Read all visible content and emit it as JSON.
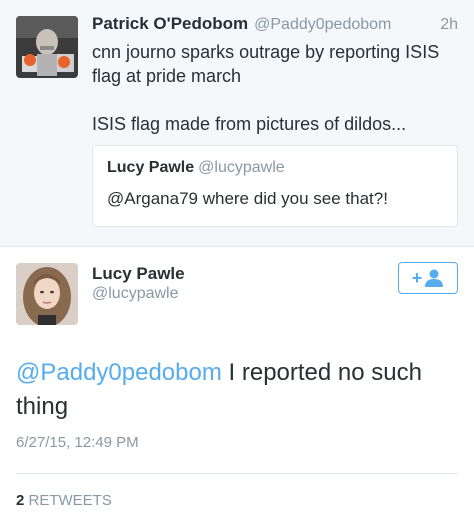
{
  "reply_tweet": {
    "author_name": "Patrick O'Pedobom",
    "author_handle": "@Paddy0pedobom",
    "time": "2h",
    "text_line1": "cnn journo sparks outrage by reporting ISIS flag at pride march",
    "text_line2": "ISIS flag made from pictures of dildos...",
    "avatar_icon": "profile-photo-icon",
    "quoted": {
      "author_name": "Lucy Pawle",
      "author_handle": "@lucypawle",
      "text": "@Argana79 where did you see that?!"
    }
  },
  "main_tweet": {
    "author_name": "Lucy Pawle",
    "author_handle": "@lucypawle",
    "avatar_icon": "profile-photo-icon",
    "follow_icon": "follow-user-icon",
    "follow_label": "+",
    "mention": "@Paddy0pedobom",
    "text_rest": " I reported no such thing",
    "timestamp": "6/27/15, 12:49 PM",
    "retweet_count": "2",
    "retweet_label": "RETWEETS"
  },
  "colors": {
    "accent": "#55acee",
    "muted": "#8899a6",
    "text": "#292f33",
    "background_alt": "#f5f8fa",
    "border": "#e1e8ed"
  }
}
